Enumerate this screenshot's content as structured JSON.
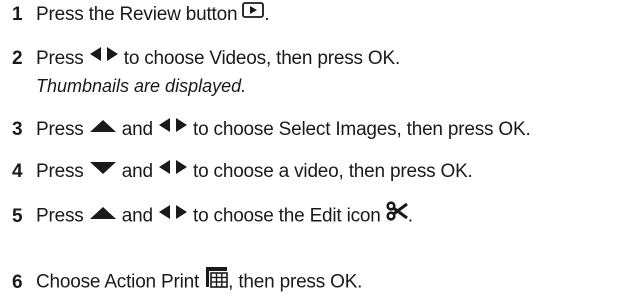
{
  "steps": [
    {
      "num": "1",
      "parts": [
        "Press the Review button ",
        "."
      ]
    },
    {
      "num": "2",
      "parts": [
        "Press ",
        " to choose Videos, then press OK."
      ],
      "note": "Thumbnails are displayed."
    },
    {
      "num": "3",
      "parts": [
        "Press ",
        " and ",
        " to choose Select Images, then press OK."
      ]
    },
    {
      "num": "4",
      "parts": [
        "Press ",
        " and ",
        " to choose a video, then press OK."
      ]
    },
    {
      "num": "5",
      "parts": [
        "Press ",
        " and ",
        " to choose the Edit icon ",
        "."
      ]
    },
    {
      "num": "6",
      "parts": [
        "Choose Action Print ",
        ", then press OK."
      ]
    }
  ],
  "icons": {
    "review": "review-button-icon",
    "left_right": "left-right-arrows-icon",
    "up": "up-arrow-icon",
    "down": "down-arrow-icon",
    "edit": "scissors-edit-icon",
    "action_print": "action-print-icon"
  }
}
